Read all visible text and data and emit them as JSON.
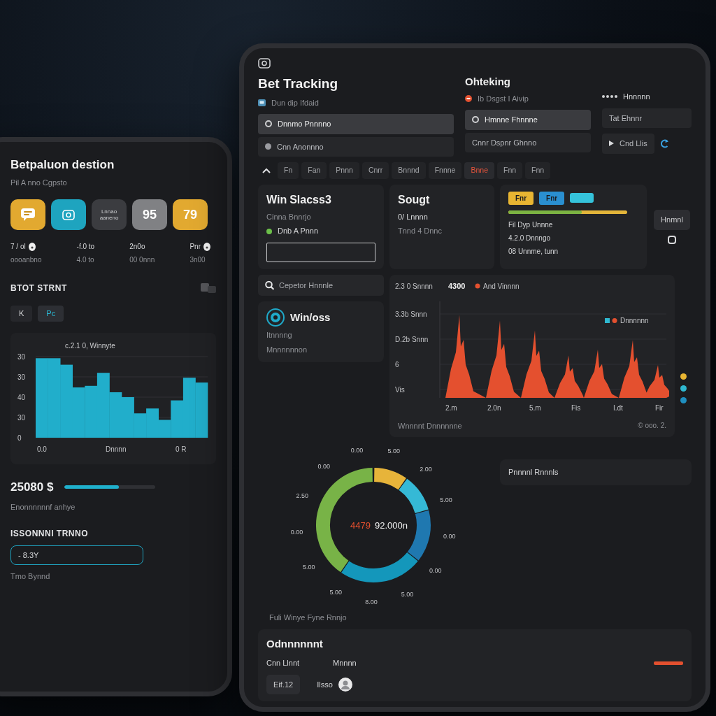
{
  "left_tablet": {
    "title": "Betpaluon destion",
    "subtitle": "Pil A nno Cgpsto",
    "tiles": [
      {
        "kind": "note",
        "color": "#e2a930"
      },
      {
        "kind": "camera",
        "color": "#1ea4bf"
      },
      {
        "kind": "caption",
        "label": "Lnnao aaneno",
        "color": "#3b3c40"
      },
      {
        "kind": "score",
        "label": "95",
        "color": "#808184"
      },
      {
        "kind": "score",
        "label": "79",
        "color": "#e2a930"
      }
    ],
    "stats": [
      {
        "kind": "with-icon",
        "label": "7 / ol",
        "value": "oooanbno"
      },
      {
        "kind": "plain",
        "label": "-f.0 to",
        "value": "4.0 to"
      },
      {
        "kind": "plain",
        "label": "2n0o",
        "value": "00 0nnn"
      },
      {
        "kind": "with-icon",
        "label": "Pnr",
        "value": "3n00"
      }
    ],
    "section_title": "BTOT STRNT",
    "tabs": [
      {
        "label": "K",
        "selected": false
      },
      {
        "label": "Pc",
        "selected": true
      }
    ],
    "histogram": {
      "title": "c.2.1 0, Winnyte",
      "y_labels": [
        "30",
        "30",
        "40",
        "30",
        "0"
      ],
      "x_labels": [
        "0.0",
        "Dnnnn",
        "0 R"
      ]
    },
    "balance": {
      "amount": "25080 $",
      "progress": {
        "level": 0.6
      },
      "caption": "Enonnnnnnf anhye"
    },
    "account": {
      "heading": "ISSONNNI TRNNO",
      "value": "- 8.3Y",
      "note": "Tmo Bynnd"
    }
  },
  "right_tablet": {
    "title": "Bet Tracking",
    "subtitle": "Dun dip Ifdaid",
    "menu": [
      {
        "label": "Dnnmo Pnnnno",
        "selected": true
      },
      {
        "label": "Cnn Anonnno",
        "selected": false
      }
    ],
    "checking": {
      "title": "Ohteking",
      "subtitle": "Ib Dsgst I Aivip",
      "items": [
        {
          "label": "Hmnne Fhnnne",
          "selected": true
        },
        {
          "label": "Cnnr Dspnr Ghnno",
          "selected": false
        }
      ]
    },
    "side_links": [
      {
        "kind": "dots",
        "label": "Hnnnnn"
      },
      {
        "kind": "button",
        "label": "Tat Ehnnr"
      },
      {
        "kind": "link",
        "label": "Cnd Llis"
      }
    ],
    "tabs": [
      {
        "label": "Fn",
        "selected": false
      },
      {
        "label": "Fan",
        "selected": false
      },
      {
        "label": "Pnnn",
        "selected": false
      },
      {
        "label": "Cnrr",
        "selected": false
      },
      {
        "label": "Bnnnd",
        "selected": false
      },
      {
        "label": "Fnnne",
        "selected": false
      },
      {
        "label": "Bnne",
        "selected": true
      },
      {
        "label": "Fnn",
        "selected": false
      },
      {
        "label": "Fnn",
        "selected": false
      }
    ],
    "win_card": {
      "title": "Win",
      "title_accent": "Slacss3",
      "subtitle": "Cinna Bnnrjo",
      "status": "Dnb A Pnnn"
    },
    "sought_card": {
      "title": "Sougt",
      "value": "0/ Lnnnn",
      "note": "Tnnd 4 Dnnc"
    },
    "summary": {
      "badges": [
        {
          "label": "Fnr",
          "color": "#e8b532"
        },
        {
          "label": "Fnr",
          "color": "#2a8fd0"
        },
        {
          "color": "#35c3db"
        }
      ],
      "bar": {
        "level": 0.62
      },
      "lines": [
        "Fil Dyp Unnne",
        "4.2.0 Dnnngo",
        "08 Unnme, tunn"
      ],
      "button": "Hnmnl"
    },
    "search": {
      "placeholder": "Cepetor Hnnnle"
    },
    "winloss": {
      "title": "Win/oss",
      "lines": [
        "Itnnnng",
        "Mnnnnnnon"
      ]
    },
    "area_chart": {
      "header": "2.3 0 Snnnn",
      "value": "4300",
      "legend": "And Vinnnn",
      "y_labels": [
        "3.3b Snnn",
        "D.2b Snnn",
        "6",
        "Vis"
      ],
      "x_labels": [
        "2.m",
        "2.0n",
        "5.m",
        "Fis",
        "I.dt",
        "Fir"
      ],
      "legend_2": "Dnnnnnn",
      "caption": "Wnnnnt Dnnnnnne",
      "footnote": "© ooo. 2."
    },
    "indicators": [
      {
        "color": "#e8b532"
      },
      {
        "color": "#2fb8d0"
      },
      {
        "color": "#1f8fc0"
      }
    ],
    "donut": {
      "center_value": "4479",
      "center_label": "92.000n",
      "labels": [
        "0.00",
        "0.00",
        "5.00",
        "2.00",
        "5.00",
        "0.00",
        "0.00",
        "5.00",
        "8.00",
        "5.00",
        "5.00",
        "0.00",
        "2.50"
      ],
      "caption": "Fuli Winye Fyne Rnnjo",
      "side_label": "Pnnnnl Rnnnls"
    },
    "bottom": {
      "heading": "Odnnnnnnt",
      "items": [
        "Cnn Llnnt",
        "Mnnnn"
      ],
      "button": "Eif.12",
      "user": "Ilsso"
    }
  }
}
